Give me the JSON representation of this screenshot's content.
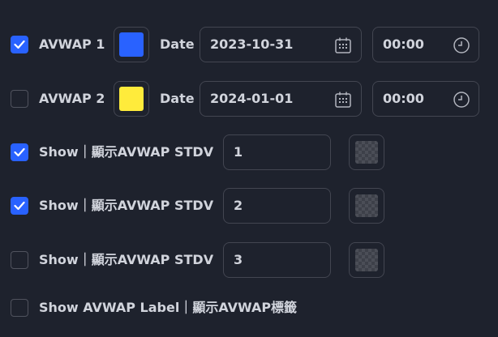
{
  "avwap1": {
    "checked": true,
    "label": "AVWAP 1",
    "color": "#2962ff",
    "date_label": "Date",
    "date_value": "2023-10-31",
    "time_value": "00:00"
  },
  "avwap2": {
    "checked": false,
    "label": "AVWAP 2",
    "color": "#ffeb3b",
    "date_label": "Date",
    "date_value": "2024-01-01",
    "time_value": "00:00"
  },
  "stdv_rows": [
    {
      "checked": true,
      "label": "Show｜顯示AVWAP STDV",
      "value": "1"
    },
    {
      "checked": true,
      "label": "Show｜顯示AVWAP STDV",
      "value": "2"
    },
    {
      "checked": false,
      "label": "Show｜顯示AVWAP STDV",
      "value": "3"
    }
  ],
  "label_row": {
    "checked": false,
    "label": "Show AVWAP Label｜顯示AVWAP標籤"
  },
  "colors": {
    "background": "#1e222d",
    "accent": "#2962ff",
    "border": "#434651",
    "text": "#d1d4dc"
  },
  "icons": {
    "calendar": "calendar-icon",
    "clock": "clock-icon",
    "check": "check-icon"
  }
}
